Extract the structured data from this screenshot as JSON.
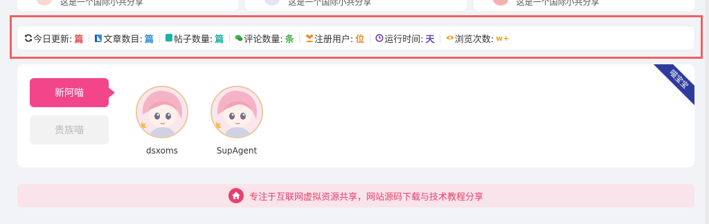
{
  "top_cards": {
    "items": [
      "这是一个国际小共分享",
      "这是一个国际小共分享",
      "这是一个国际小共分享"
    ]
  },
  "stats": [
    {
      "label": "今日更新:",
      "value": "篇",
      "color": "#e94e4e",
      "icon": "refresh-icon"
    },
    {
      "label": "文章数目:",
      "value": "篇",
      "color": "#2f8bd9",
      "icon": "book-icon"
    },
    {
      "label": "帖子数量:",
      "value": "篇",
      "color": "#1ab3a3",
      "icon": "note-icon"
    },
    {
      "label": "评论数量:",
      "value": "条",
      "color": "#48b34a",
      "icon": "chat-icon"
    },
    {
      "label": "注册用户:",
      "value": "位",
      "color": "#f08a1f",
      "icon": "users-icon"
    },
    {
      "label": "运行时间:",
      "value": "天",
      "color": "#6a3fb3",
      "icon": "clock-icon"
    },
    {
      "label": "浏览次数:",
      "value": "w+",
      "color": "#f0a21f",
      "icon": "eye-icon"
    }
  ],
  "tabs": {
    "new": "新阿喵",
    "noble": "贵族喵"
  },
  "users": [
    {
      "name": "dsxoms"
    },
    {
      "name": "SupAgent"
    }
  ],
  "ribbon": "喵宝宝",
  "footer": {
    "text": "专注于互联网虚拟资源共享，网站源码下载与技术教程分享"
  }
}
